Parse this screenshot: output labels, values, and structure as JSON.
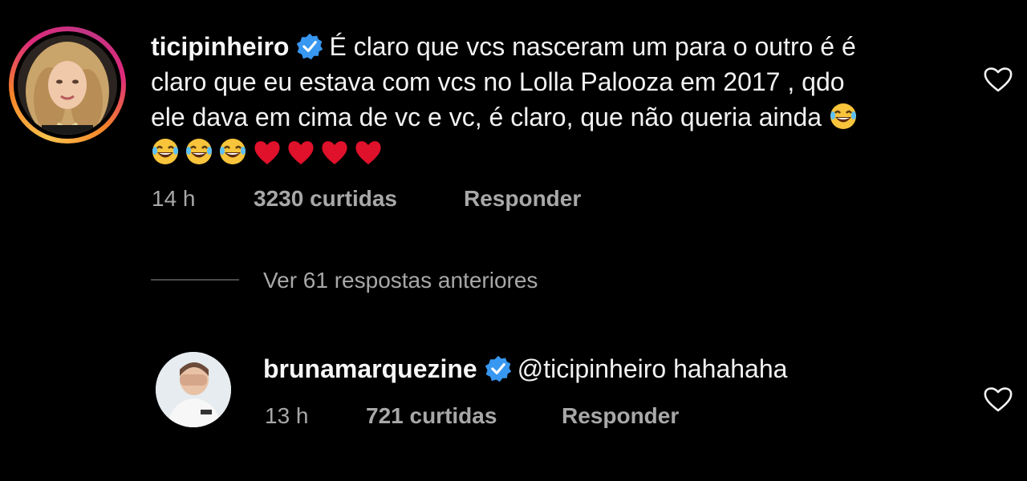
{
  "comment": {
    "username": "ticipinheiro",
    "text_line1": "É claro que vcs nasceram um para o outro é é",
    "text_line2": "claro que eu estava com vcs no Lolla Palooza em 2017 , qdo",
    "text_line3": "ele dava em cima de vc e vc, é claro, que não queria ainda",
    "time": "14 h",
    "likes": "3230 curtidas",
    "reply_label": "Responder",
    "emoji_laugh": "😂",
    "emoji_heart": "❤️"
  },
  "replies_toggle": {
    "label": "Ver 61 respostas anteriores"
  },
  "reply": {
    "username": "brunamarquezine",
    "mention": "@ticipinheiro",
    "text": "hahahaha",
    "time": "13 h",
    "likes": "721 curtidas",
    "reply_label": "Responder"
  },
  "colors": {
    "background": "#000000",
    "text": "#f2f2f2",
    "secondary_text": "#a8a8a8",
    "verified_blue": "#3897f0",
    "heart_red": "#e0112b"
  },
  "icons": {
    "verified": "verified-badge-icon",
    "like": "heart-outline-icon"
  }
}
